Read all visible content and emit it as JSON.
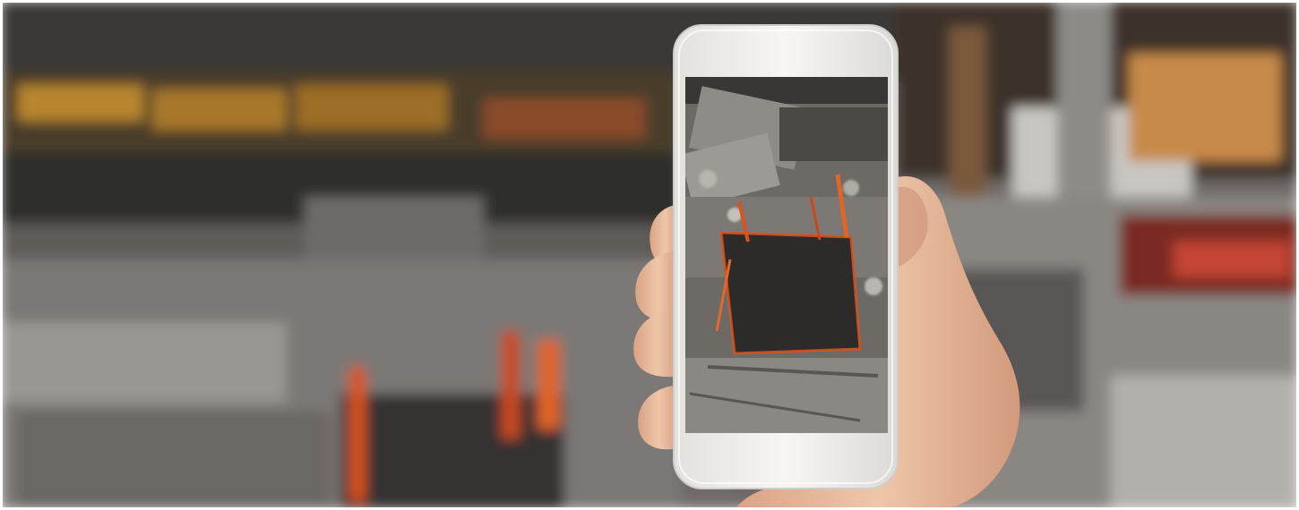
{
  "scene": {
    "description_tags": [
      "burned-building-background",
      "hand-holding-smartphone",
      "phone-screen-photo"
    ],
    "colors": {
      "ash_gray": "#8a8783",
      "char_dark": "#2b2927",
      "ember_orange": "#d9531e",
      "rust_yellow": "#b8862e",
      "phone_white": "#f1f0ee",
      "skin": "#e5b89a",
      "skin_shadow": "#c9927a"
    }
  }
}
